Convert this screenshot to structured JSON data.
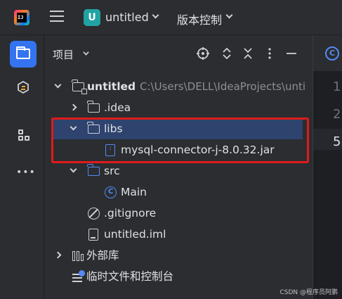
{
  "titlebar": {
    "project_badge": "U",
    "project_name": "untitled",
    "vcs_label": "版本控制"
  },
  "toolstrip": {
    "items": [
      "folder-icon",
      "language-icon",
      "structure-icon",
      "more-icon"
    ],
    "active": "folder-icon"
  },
  "panel": {
    "title": "项目",
    "header_icons": [
      "locate-icon",
      "expand-all-icon",
      "collapse-all-icon",
      "options-icon",
      "hide-icon"
    ]
  },
  "tree": {
    "root_name": "untitled",
    "root_path": "C:\\Users\\DELL\\IdeaProjects\\unti",
    "idea": ".idea",
    "libs": "libs",
    "jar": "mysql-connector-j-8.0.32.jar",
    "src": "src",
    "main_class": "Main",
    "gitignore": ".gitignore",
    "iml": "untitled.iml",
    "external_libs": "外部库",
    "scratches": "临时文件和控制台"
  },
  "editor": {
    "tab_icon_letter": "C",
    "line_numbers": [
      "1",
      "2",
      "5"
    ]
  },
  "watermark": "CSDN @程序员阿鹏",
  "colors": {
    "accent": "#3574f0",
    "selection": "#2e436e",
    "highlight_border": "#e01b1b",
    "project_badge": "#21a3a3"
  }
}
